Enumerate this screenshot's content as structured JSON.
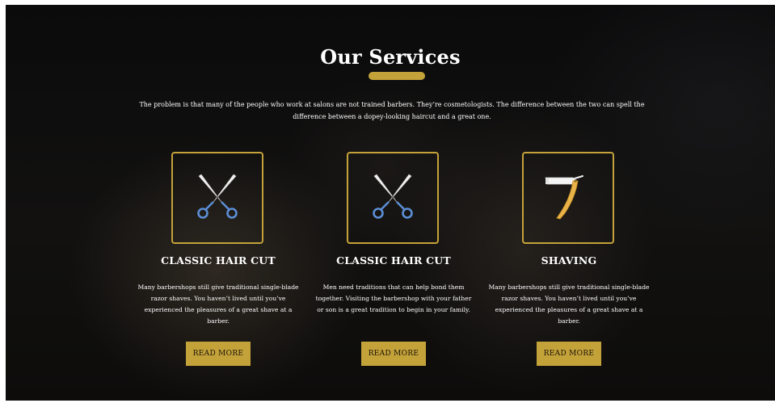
{
  "section": {
    "title": "Our Services",
    "intro": "The problem is that many of the people who work at salons are not trained barbers. They’re cosmetologists. The difference between the two can spell the difference between a dopey-looking haircut and a great one."
  },
  "services": [
    {
      "icon": "scissors-icon",
      "title": "CLASSIC HAIR CUT",
      "description": "Many barbershops still give traditional single-blade razor shaves. You haven’t lived until you’ve experienced the pleasures of a great shave at a barber.",
      "button_label": "READ MORE"
    },
    {
      "icon": "scissors-icon",
      "title": "CLASSIC HAIR CUT",
      "description": "Men need traditions that can help bond them together. Visiting the barbershop with your father or son is a great tradition to begin in your family.",
      "button_label": "READ MORE"
    },
    {
      "icon": "straight-razor-icon",
      "title": "SHAVING",
      "description": "Many barbershops still give traditional single-blade razor shaves. You haven’t lived until you’ve experienced the pleasures of a great shave at a barber.",
      "button_label": "READ MORE"
    }
  ],
  "colors": {
    "accent": "#c4a23a",
    "background": "#0f0e0d",
    "text": "#ffffff",
    "scissor_handle": "#5b8fd6"
  }
}
